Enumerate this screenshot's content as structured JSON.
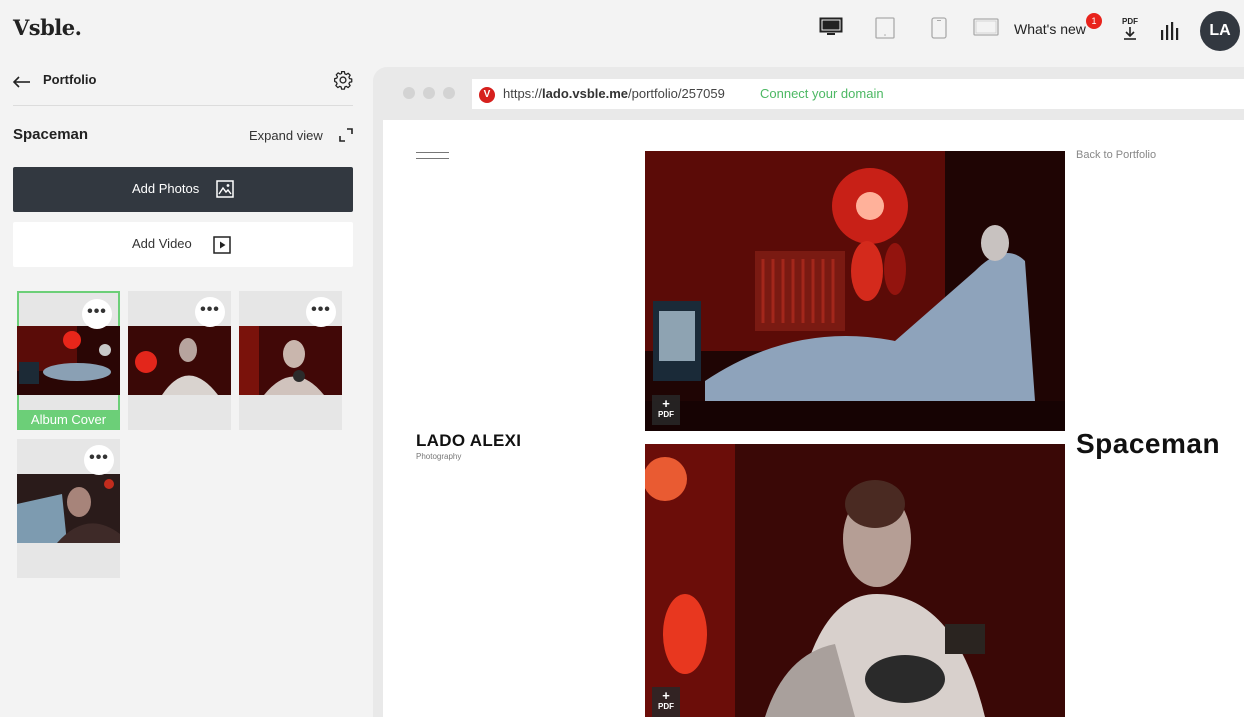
{
  "app": {
    "logo": "Vsble.",
    "whats_new": "What's new",
    "whats_new_count": "1",
    "pdf_label": "PDF",
    "avatar_initials": "LA"
  },
  "sidebar": {
    "back_label": "Portfolio",
    "album_title": "Spaceman",
    "expand_label": "Expand view",
    "add_photos_label": "Add Photos",
    "add_video_label": "Add Video",
    "menu_dots": "•••",
    "cover_label": "Album Cover"
  },
  "browser": {
    "url_prefix": "https://",
    "url_domain": "lado.vsble.me",
    "url_path": "/portfolio/257059",
    "connect_domain": "Connect your domain",
    "favicon_letter": "V"
  },
  "site": {
    "author_name": "LADO ALEXI",
    "author_subtitle": "Photography",
    "back_link": "Back to Portfolio",
    "album_title": "Spaceman",
    "pdf_chip_plus": "+",
    "pdf_chip_label": "PDF"
  },
  "colors": {
    "dark_button": "#323840",
    "accent_green": "#6ccf78",
    "badge_red": "#e8231c"
  }
}
